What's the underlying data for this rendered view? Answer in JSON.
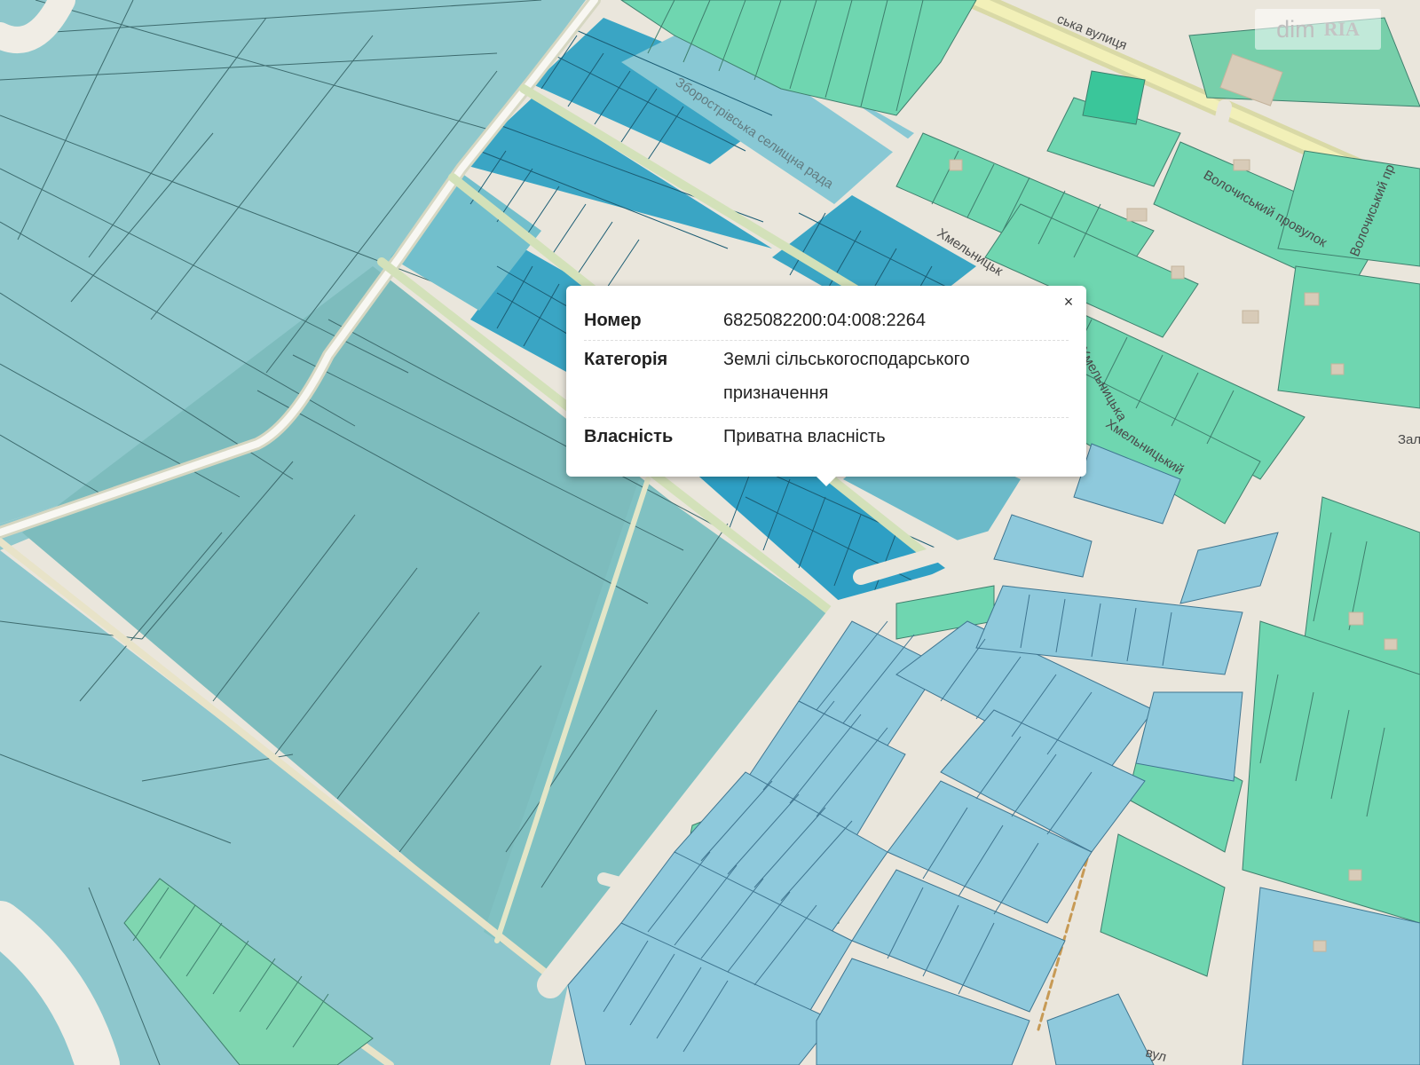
{
  "map": {
    "street_labels": [
      "ська вулиця",
      "Зборострівська селищна рада",
      "Хмельницьк",
      "Волочиський провулок",
      "Волочиський пр",
      "Хмельницька",
      "Хмельницький",
      "Зал",
      "вул"
    ]
  },
  "parcel_popup": {
    "close_label": "×",
    "rows": [
      {
        "key": "Номер",
        "value": "6825082200:04:008:2264"
      },
      {
        "key": "Категорія",
        "value_lines": [
          "Землі сільськогосподарського",
          "призначення"
        ]
      },
      {
        "key": "Власність",
        "value": "Приватна власність"
      }
    ]
  },
  "watermark": {
    "dim": "dim",
    "ria": "RIA"
  },
  "colors": {
    "field": "#8fc8cc",
    "field_selected_region": "#7dbcbd",
    "parcel_blue": "#3aa5c4",
    "parcel_blue_dark": "#2e93b5",
    "parcel_green": "#6fd6b0",
    "parcel_lightblue": "#8ec9dc",
    "road": "#f6f4ef",
    "road_edge": "#cfe2b8",
    "building": "#d8cbb8"
  }
}
